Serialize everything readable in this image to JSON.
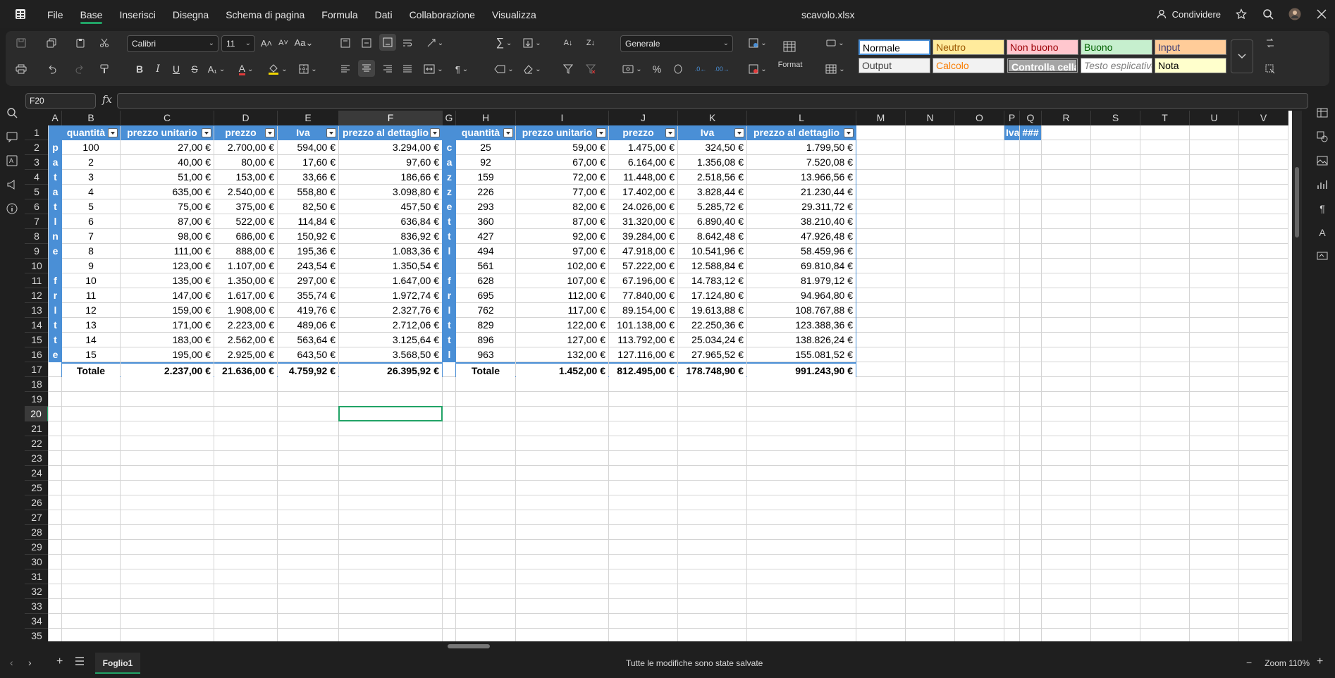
{
  "app": {
    "title": "scavolo.xlsx"
  },
  "menu": [
    "File",
    "Base",
    "Inserisci",
    "Disegna",
    "Schema di pagina",
    "Formula",
    "Dati",
    "Collaborazione",
    "Visualizza"
  ],
  "topright": {
    "share_label": "Condividere"
  },
  "ribbon": {
    "font_name": "Calibri",
    "font_size": "11",
    "number_format": "Generale",
    "format_label": "Format",
    "cell_styles": [
      "Normale",
      "Neutro",
      "Non buono",
      "Buono",
      "Input",
      "Output",
      "Calcolo",
      "Controlla cella",
      "Testo esplicativo",
      "Nota"
    ]
  },
  "formula_bar": {
    "name_box": "F20",
    "fx": "fx",
    "value": ""
  },
  "columns": [
    "A",
    "B",
    "C",
    "D",
    "E",
    "F",
    "G",
    "H",
    "I",
    "J",
    "K",
    "L",
    "M",
    "N",
    "O",
    "P",
    "Q",
    "R",
    "S",
    "T",
    "U",
    "V"
  ],
  "rows": [
    "1",
    "2",
    "3",
    "4",
    "5",
    "6",
    "7",
    "8",
    "9",
    "10",
    "11",
    "12",
    "13",
    "14",
    "15",
    "16",
    "17",
    "18",
    "19",
    "20",
    "21",
    "22",
    "23",
    "24",
    "25",
    "26",
    "27",
    "28",
    "29",
    "30",
    "31",
    "32",
    "33",
    "34",
    "35"
  ],
  "selected_cell": "F20",
  "table1": {
    "side_label": [
      "p",
      "a",
      "t",
      "a",
      "t",
      "l",
      "n",
      "e",
      "",
      "f",
      "r",
      "l",
      "t",
      "t",
      "e"
    ],
    "headers": [
      "quantità",
      "prezzo unitario",
      "prezzo",
      "Iva",
      "prezzo al dettaglio"
    ],
    "rows": [
      [
        "100",
        "27,00 €",
        "2.700,00 €",
        "594,00 €",
        "3.294,00 €"
      ],
      [
        "2",
        "40,00 €",
        "80,00 €",
        "17,60 €",
        "97,60 €"
      ],
      [
        "3",
        "51,00 €",
        "153,00 €",
        "33,66 €",
        "186,66 €"
      ],
      [
        "4",
        "635,00 €",
        "2.540,00 €",
        "558,80 €",
        "3.098,80 €"
      ],
      [
        "5",
        "75,00 €",
        "375,00 €",
        "82,50 €",
        "457,50 €"
      ],
      [
        "6",
        "87,00 €",
        "522,00 €",
        "114,84 €",
        "636,84 €"
      ],
      [
        "7",
        "98,00 €",
        "686,00 €",
        "150,92 €",
        "836,92 €"
      ],
      [
        "8",
        "111,00 €",
        "888,00 €",
        "195,36 €",
        "1.083,36 €"
      ],
      [
        "9",
        "123,00 €",
        "1.107,00 €",
        "243,54 €",
        "1.350,54 €"
      ],
      [
        "10",
        "135,00 €",
        "1.350,00 €",
        "297,00 €",
        "1.647,00 €"
      ],
      [
        "11",
        "147,00 €",
        "1.617,00 €",
        "355,74 €",
        "1.972,74 €"
      ],
      [
        "12",
        "159,00 €",
        "1.908,00 €",
        "419,76 €",
        "2.327,76 €"
      ],
      [
        "13",
        "171,00 €",
        "2.223,00 €",
        "489,06 €",
        "2.712,06 €"
      ],
      [
        "14",
        "183,00 €",
        "2.562,00 €",
        "563,64 €",
        "3.125,64 €"
      ],
      [
        "15",
        "195,00 €",
        "2.925,00 €",
        "643,50 €",
        "3.568,50 €"
      ]
    ],
    "total": [
      "Totale",
      "2.237,00 €",
      "21.636,00 €",
      "4.759,92 €",
      "26.395,92 €"
    ]
  },
  "table2": {
    "side_label": [
      "c",
      "a",
      "z",
      "z",
      "e",
      "t",
      "t",
      "l",
      "",
      "f",
      "r",
      "l",
      "t",
      "t",
      "l"
    ],
    "headers": [
      "quantità",
      "prezzo unitario",
      "prezzo",
      "Iva",
      "prezzo al dettaglio"
    ],
    "rows": [
      [
        "25",
        "59,00 €",
        "1.475,00 €",
        "324,50 €",
        "1.799,50 €"
      ],
      [
        "92",
        "67,00 €",
        "6.164,00 €",
        "1.356,08 €",
        "7.520,08 €"
      ],
      [
        "159",
        "72,00 €",
        "11.448,00 €",
        "2.518,56 €",
        "13.966,56 €"
      ],
      [
        "226",
        "77,00 €",
        "17.402,00 €",
        "3.828,44 €",
        "21.230,44 €"
      ],
      [
        "293",
        "82,00 €",
        "24.026,00 €",
        "5.285,72 €",
        "29.311,72 €"
      ],
      [
        "360",
        "87,00 €",
        "31.320,00 €",
        "6.890,40 €",
        "38.210,40 €"
      ],
      [
        "427",
        "92,00 €",
        "39.284,00 €",
        "8.642,48 €",
        "47.926,48 €"
      ],
      [
        "494",
        "97,00 €",
        "47.918,00 €",
        "10.541,96 €",
        "58.459,96 €"
      ],
      [
        "561",
        "102,00 €",
        "57.222,00 €",
        "12.588,84 €",
        "69.810,84 €"
      ],
      [
        "628",
        "107,00 €",
        "67.196,00 €",
        "14.783,12 €",
        "81.979,12 €"
      ],
      [
        "695",
        "112,00 €",
        "77.840,00 €",
        "17.124,80 €",
        "94.964,80 €"
      ],
      [
        "762",
        "117,00 €",
        "89.154,00 €",
        "19.613,88 €",
        "108.767,88 €"
      ],
      [
        "829",
        "122,00 €",
        "101.138,00 €",
        "22.250,36 €",
        "123.388,36 €"
      ],
      [
        "896",
        "127,00 €",
        "113.792,00 €",
        "25.034,24 €",
        "138.826,24 €"
      ],
      [
        "963",
        "132,00 €",
        "127.116,00 €",
        "27.965,52 €",
        "155.081,52 €"
      ]
    ],
    "total": [
      "Totale",
      "1.452,00 €",
      "812.495,00 €",
      "178.748,90 €",
      "991.243,90 €"
    ]
  },
  "extra": {
    "p1": "Iva",
    "q1": "###"
  },
  "bottom": {
    "sheet_tab": "Foglio1",
    "status": "Tutte le modifiche sono state salvate",
    "zoom": "Zoom 110%"
  },
  "colors": {
    "accent": "#21a366",
    "table_header": "#4a8fd6",
    "table_border": "#4a8fd6"
  }
}
